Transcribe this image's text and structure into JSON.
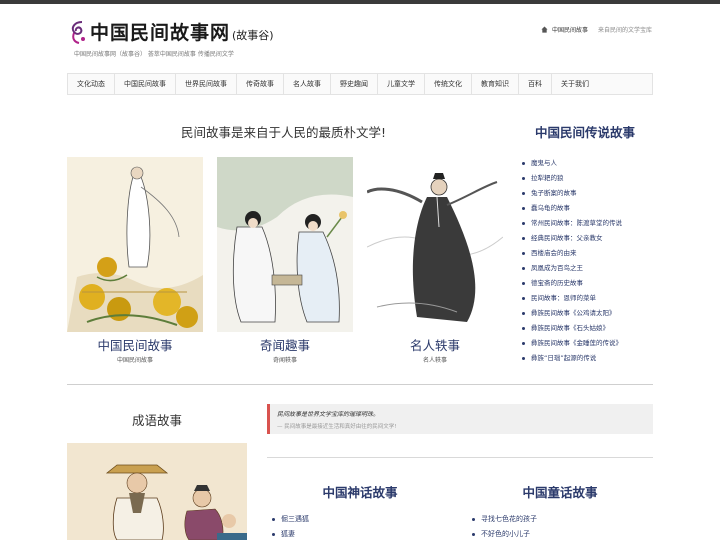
{
  "header": {
    "site_title": "中国民间故事网",
    "site_sub": "(故事谷)",
    "tagline": "中国民间故事网（故事谷） 荟萃中国民间故事  传播民间文学",
    "home_link": "中国民间故事",
    "slogan": "来自民间的文学宝库"
  },
  "nav": {
    "items": [
      "文化动态",
      "中国民间故事",
      "世界民间故事",
      "传奇故事",
      "名人故事",
      "野史趣闻",
      "儿童文学",
      "传统文化",
      "教育知识",
      "百科",
      "关于我们"
    ]
  },
  "main": {
    "headline": "民间故事是来自于人民的最质朴文学!",
    "cards": [
      {
        "title": "中国民间故事",
        "sub": "中国民间故事"
      },
      {
        "title": "奇闻趣事",
        "sub": "奇闻轶事"
      },
      {
        "title": "名人轶事",
        "sub": "名人轶事"
      }
    ]
  },
  "sidebar": {
    "title": "中国民间传说故事",
    "items": [
      "魔鬼与人",
      "拉犁耙的狼",
      "兔子断案的故事",
      "蠢乌龟的故事",
      "常州民间故事：陈渡草堂的传说",
      "经典民间故事：父亲教女",
      "西楼庙会的由来",
      "凤凰成为百鸟之王",
      "德宝斋的历史故事",
      "民间故事：恩师的菜单",
      "彝族民间故事《公鸡请太阳》",
      "彝族民间故事《石头姑娘》",
      "彝族民间故事《金睡莲的传说》",
      "彝族“日瑙”起源的传说"
    ]
  },
  "idiom": {
    "title": "成语故事"
  },
  "quote": {
    "main": "民间故事是世界文学宝库的璀璨明珠。",
    "sub": "— 民间故事是最接近生活和真好由往的民间文学!"
  },
  "myth": {
    "title": "中国神话故事",
    "items": [
      "倔三遇狐",
      "狐妻"
    ]
  },
  "fairy": {
    "title": "中国童话故事",
    "items": [
      "寻找七色花的孩子",
      "不好色的小儿子"
    ]
  }
}
